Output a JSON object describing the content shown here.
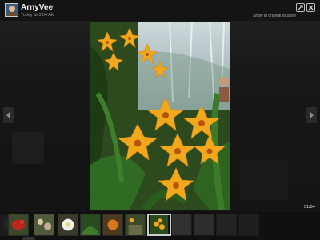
{
  "header": {
    "user_name": "ArnyVee",
    "timestamp": "Today at 3:54 AM",
    "original_location_link": "Show in original location",
    "popout_icon": "popout-icon",
    "close_icon": "close-icon"
  },
  "viewer": {
    "counter": "51/54",
    "prev_icon": "chevron-left-icon",
    "next_icon": "chevron-right-icon"
  },
  "filmstrip": {
    "thumbnails": [
      {
        "subject": "dark"
      },
      {
        "subject": "red bird"
      },
      {
        "subject": "flowers"
      },
      {
        "subject": "white flower"
      },
      {
        "subject": "leaves"
      },
      {
        "subject": "orange flower"
      },
      {
        "subject": "garden"
      },
      {
        "subject": "yellow orchids",
        "active": true
      },
      {
        "subject": "grey"
      },
      {
        "subject": "grey"
      },
      {
        "subject": "grey"
      },
      {
        "subject": "grey"
      }
    ]
  },
  "colors": {
    "background": "#181818",
    "orchid_yellow": "#f2a81d",
    "leaf_green": "#2f6b22"
  }
}
